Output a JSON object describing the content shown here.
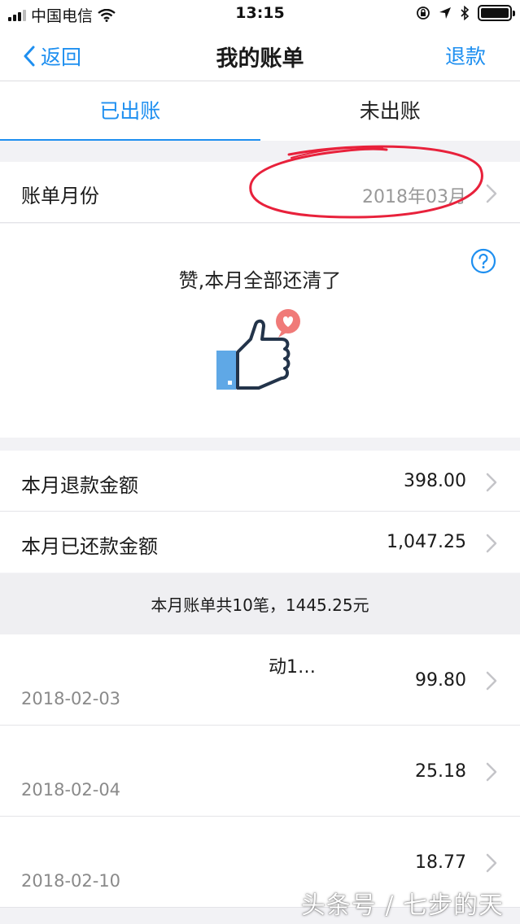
{
  "status_bar": {
    "carrier": "中国电信",
    "time": "13:15"
  },
  "nav": {
    "back_label": "返回",
    "title": "我的账单",
    "refund_label": "退款"
  },
  "tabs": [
    {
      "label": "已出账",
      "active": true
    },
    {
      "label": "未出账",
      "active": false
    }
  ],
  "bill_month": {
    "label": "账单月份",
    "value": "2018年03月"
  },
  "summary": {
    "message": "赞,本月全部还清了",
    "help_icon": "question-circle-icon",
    "illustration": "thumbs-up-heart-icon"
  },
  "stats": [
    {
      "label": "本月退款金额",
      "value": "398.00"
    },
    {
      "label": "本月已还款金额",
      "value": "1,047.25"
    }
  ],
  "bill_summary": "本月账单共10笔，1445.25元",
  "bills": [
    {
      "name": "动1…",
      "date": "2018-02-03",
      "amount": "99.80"
    },
    {
      "name": "",
      "date": "2018-02-04",
      "amount": "25.18"
    },
    {
      "name": "",
      "date": "2018-02-10",
      "amount": "18.77"
    }
  ],
  "watermark": "头条号 / 七步的天",
  "colors": {
    "accent": "#1e8ff0",
    "annotation": "#e8213b",
    "heart_badge": "#f07a78",
    "thumb_cuff": "#5fa8e6"
  }
}
